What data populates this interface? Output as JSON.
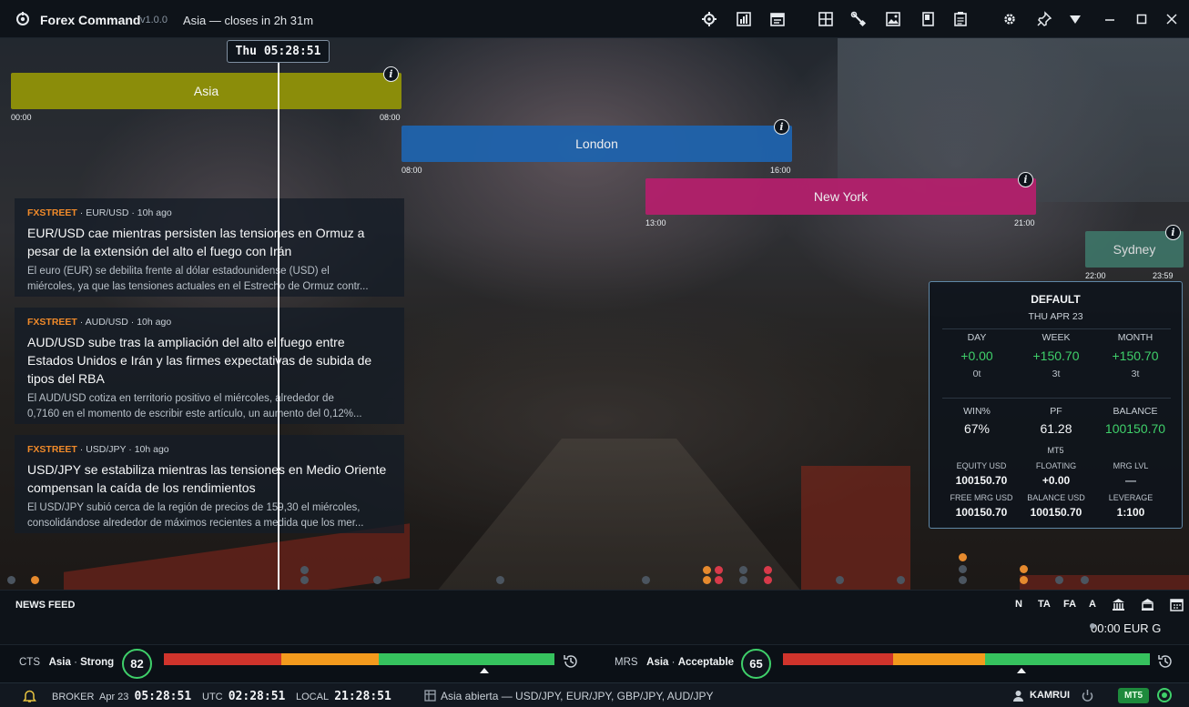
{
  "titlebar": {
    "app_name": "Forex Command",
    "version": "v1.0.0",
    "session_info": "Asia  —  closes in 2h 31m",
    "icons": [
      "sessions-icon",
      "chart-icon",
      "calendar-icon",
      "grid-icon",
      "tools-icon",
      "image-icon",
      "book-icon",
      "notes-icon",
      "settings-icon",
      "pin-icon",
      "dropdown-icon",
      "minimize-icon",
      "maximize-icon",
      "close-icon"
    ]
  },
  "timeline": {
    "current_time": "Thu 05:28:51",
    "sessions": [
      {
        "name": "Asia",
        "start": "00:00",
        "end": "08:00",
        "color": "#8b8d0a"
      },
      {
        "name": "London",
        "start": "08:00",
        "end": "16:00",
        "color": "#1f63ad"
      },
      {
        "name": "New York",
        "start": "13:00",
        "end": "21:00",
        "color": "#b3206c"
      },
      {
        "name": "Sydney",
        "start": "22:00",
        "end": "23:59",
        "color": "#3f7a6c"
      }
    ]
  },
  "news": [
    {
      "source": "FXSTREET",
      "pair": "EUR/USD",
      "age": "10h ago",
      "title": "EUR/USD cae mientras persisten las tensiones en Ormuz a pesar de la extensión del alto el fuego con Irán",
      "body_line1": "El euro (EUR) se debilita frente al dólar estadounidense (USD) el",
      "body_line2": "miércoles, ya que las tensiones actuales en el Estrecho de Ormuz contr..."
    },
    {
      "source": "FXSTREET",
      "pair": "AUD/USD",
      "age": "10h ago",
      "title": "AUD/USD sube tras la ampliación del alto el fuego entre Estados Unidos e Irán y las firmes expectativas de subida de tipos del RBA",
      "body_line1": "El AUD/USD cotiza en territorio positivo el miércoles, alrededor de",
      "body_line2": "0,7160 en el momento de escribir este artículo, un aumento del 0,12%..."
    },
    {
      "source": "FXSTREET",
      "pair": "USD/JPY",
      "age": "10h ago",
      "title": "USD/JPY se estabiliza mientras las tensiones en Medio Oriente compensan la caída de los rendimientos",
      "body_line1": "El USD/JPY subió cerca de la región de precios de 159,30 el miércoles,",
      "body_line2": "consolidándose alrededor de máximos recientes a medida que los mer..."
    }
  ],
  "stats": {
    "header": "DEFAULT",
    "date": "THU  APR  23",
    "day": {
      "label": "DAY",
      "value": "+0.00",
      "trades": "0t"
    },
    "week": {
      "label": "WEEK",
      "value": "+150.70",
      "trades": "3t"
    },
    "month": {
      "label": "MONTH",
      "value": "+150.70",
      "trades": "3t"
    },
    "win": {
      "label": "WIN%",
      "value": "67%"
    },
    "pf": {
      "label": "PF",
      "value": "61.28"
    },
    "balance": {
      "label": "BALANCE",
      "value": "100150.70"
    },
    "platform": "MT5",
    "equity": {
      "label": "EQUITY USD",
      "value": "100150.70"
    },
    "floating": {
      "label": "FLOATING",
      "value": "+0.00"
    },
    "mrg_lvl": {
      "label": "MRG LVL",
      "value": "—"
    },
    "free_mrg": {
      "label": "FREE MRG USD",
      "value": "100150.70"
    },
    "balance_usd": {
      "label": "BALANCE USD",
      "value": "100150.70"
    },
    "leverage": {
      "label": "LEVERAGE",
      "value": "1:100"
    }
  },
  "newsfeed": {
    "title": "NEWS FEED",
    "filters": [
      "N",
      "TA",
      "FA",
      "A"
    ],
    "clock": "00:00  EUR  G"
  },
  "strength": {
    "cts_label": "CTS",
    "cts_session": "Asia",
    "cts_rating": "Strong",
    "cts_score": "82",
    "mrs_label": "MRS",
    "mrs_session": "Asia",
    "mrs_rating": "Acceptable",
    "mrs_score": "65"
  },
  "status": {
    "broker_label": "BROKER",
    "broker_date": "Apr  23",
    "broker_time": "05:28:51",
    "utc_label": "UTC",
    "utc_time": "02:28:51",
    "local_label": "LOCAL",
    "local_time": "21:28:51",
    "session_pairs": "Asia abierta — USD/JPY, EUR/JPY, GBP/JPY, AUD/JPY",
    "user": "KAMRUI",
    "platform_badge": "MT5"
  },
  "colors": {
    "accent_green": "#3fd06a",
    "source_orange": "#f08a2a",
    "meter_red": "#d0342c",
    "meter_orange": "#f39a1d",
    "meter_green": "#36c25e"
  }
}
